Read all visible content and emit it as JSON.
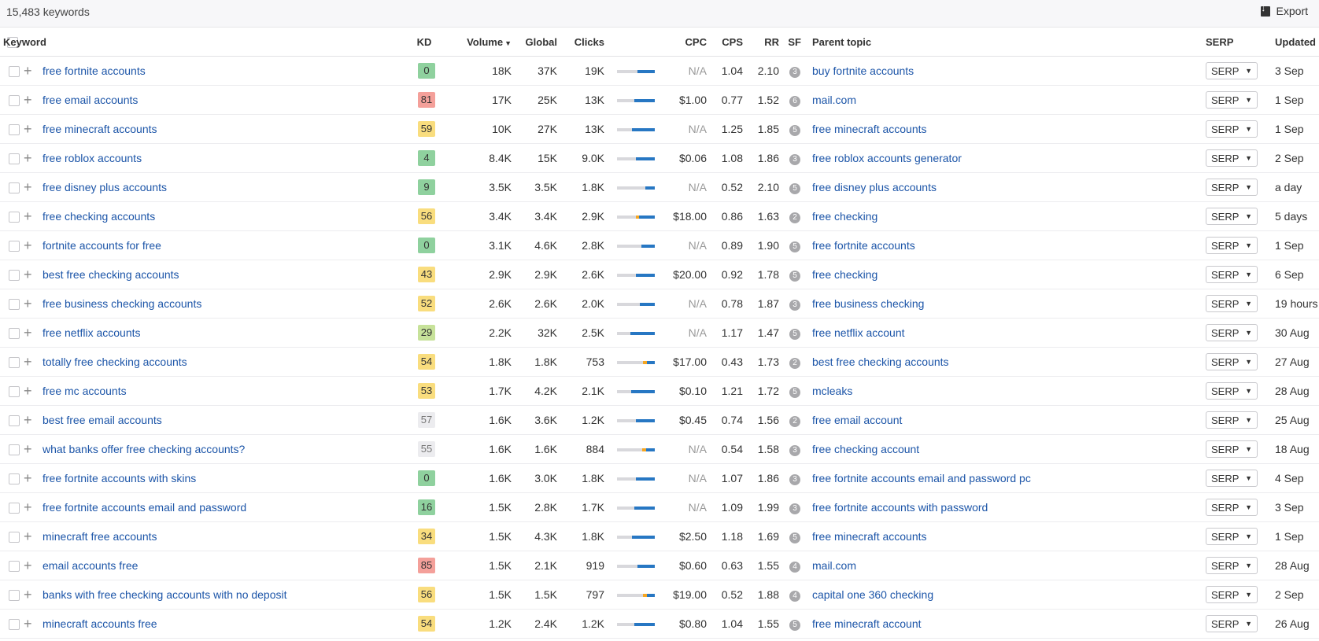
{
  "header": {
    "count": "15,483 keywords",
    "export_label": "Export"
  },
  "columns": {
    "keyword": "Keyword",
    "kd": "KD",
    "volume": "Volume",
    "global": "Global",
    "clicks": "Clicks",
    "cpc": "CPC",
    "cps": "CPS",
    "rr": "RR",
    "sf": "SF",
    "parent": "Parent topic",
    "serp": "SERP",
    "updated": "Updated"
  },
  "serp_label": "SERP",
  "colors": {
    "kd_green": "#8fd19e",
    "kd_lightgreen": "#c7e29a",
    "kd_yellow": "#f9dd7e",
    "kd_red": "#f4a09a",
    "kd_gray": "#ececef",
    "link": "#1c55a8",
    "bar_blue": "#2777c3",
    "bar_orange": "#f5a623"
  },
  "rows": [
    {
      "kw": "free fortnite accounts",
      "kd": "0",
      "kd_color": "#8fd19e",
      "vol": "18K",
      "glob": "37K",
      "clicks": "19K",
      "paid": 0,
      "org": 0.45,
      "cpc": "N/A",
      "cps": "1.04",
      "rr": "2.10",
      "sf": "3",
      "parent": "buy fortnite accounts",
      "upd": "3 Sep"
    },
    {
      "kw": "free email accounts",
      "kd": "81",
      "kd_color": "#f4a09a",
      "vol": "17K",
      "glob": "25K",
      "clicks": "13K",
      "paid": 0,
      "org": 0.55,
      "cpc": "$1.00",
      "cps": "0.77",
      "rr": "1.52",
      "sf": "6",
      "parent": "mail.com",
      "upd": "1 Sep"
    },
    {
      "kw": "free minecraft accounts",
      "kd": "59",
      "kd_color": "#f9dd7e",
      "vol": "10K",
      "glob": "27K",
      "clicks": "13K",
      "paid": 0,
      "org": 0.6,
      "cpc": "N/A",
      "cps": "1.25",
      "rr": "1.85",
      "sf": "5",
      "parent": "free minecraft accounts",
      "upd": "1 Sep"
    },
    {
      "kw": "free roblox accounts",
      "kd": "4",
      "kd_color": "#8fd19e",
      "vol": "8.4K",
      "glob": "15K",
      "clicks": "9.0K",
      "paid": 0,
      "org": 0.5,
      "cpc": "$0.06",
      "cps": "1.08",
      "rr": "1.86",
      "sf": "3",
      "parent": "free roblox accounts generator",
      "upd": "2 Sep"
    },
    {
      "kw": "free disney plus accounts",
      "kd": "9",
      "kd_color": "#8fd19e",
      "vol": "3.5K",
      "glob": "3.5K",
      "clicks": "1.8K",
      "paid": 0,
      "org": 0.25,
      "cpc": "N/A",
      "cps": "0.52",
      "rr": "2.10",
      "sf": "5",
      "parent": "free disney plus accounts",
      "upd": "a day"
    },
    {
      "kw": "free checking accounts",
      "kd": "56",
      "kd_color": "#f9dd7e",
      "vol": "3.4K",
      "glob": "3.4K",
      "clicks": "2.9K",
      "paid": 0.08,
      "org": 0.42,
      "cpc": "$18.00",
      "cps": "0.86",
      "rr": "1.63",
      "sf": "2",
      "parent": "free checking",
      "upd": "5 days"
    },
    {
      "kw": "fortnite accounts for free",
      "kd": "0",
      "kd_color": "#8fd19e",
      "vol": "3.1K",
      "glob": "4.6K",
      "clicks": "2.8K",
      "paid": 0,
      "org": 0.35,
      "cpc": "N/A",
      "cps": "0.89",
      "rr": "1.90",
      "sf": "5",
      "parent": "free fortnite accounts",
      "upd": "1 Sep"
    },
    {
      "kw": "best free checking accounts",
      "kd": "43",
      "kd_color": "#f9dd7e",
      "vol": "2.9K",
      "glob": "2.9K",
      "clicks": "2.6K",
      "paid": 0,
      "org": 0.5,
      "cpc": "$20.00",
      "cps": "0.92",
      "rr": "1.78",
      "sf": "5",
      "parent": "free checking",
      "upd": "6 Sep"
    },
    {
      "kw": "free business checking accounts",
      "kd": "52",
      "kd_color": "#f9dd7e",
      "vol": "2.6K",
      "glob": "2.6K",
      "clicks": "2.0K",
      "paid": 0,
      "org": 0.4,
      "cpc": "N/A",
      "cps": "0.78",
      "rr": "1.87",
      "sf": "3",
      "parent": "free business checking",
      "upd": "19 hours"
    },
    {
      "kw": "free netflix accounts",
      "kd": "29",
      "kd_color": "#c7e29a",
      "vol": "2.2K",
      "glob": "32K",
      "clicks": "2.5K",
      "paid": 0,
      "org": 0.65,
      "cpc": "N/A",
      "cps": "1.17",
      "rr": "1.47",
      "sf": "5",
      "parent": "free netflix account",
      "upd": "30 Aug"
    },
    {
      "kw": "totally free checking accounts",
      "kd": "54",
      "kd_color": "#f9dd7e",
      "vol": "1.8K",
      "glob": "1.8K",
      "clicks": "753",
      "paid": 0.1,
      "org": 0.2,
      "cpc": "$17.00",
      "cps": "0.43",
      "rr": "1.73",
      "sf": "2",
      "parent": "best free checking accounts",
      "upd": "27 Aug"
    },
    {
      "kw": "free mc accounts",
      "kd": "53",
      "kd_color": "#f9dd7e",
      "vol": "1.7K",
      "glob": "4.2K",
      "clicks": "2.1K",
      "paid": 0,
      "org": 0.62,
      "cpc": "$0.10",
      "cps": "1.21",
      "rr": "1.72",
      "sf": "5",
      "parent": "mcleaks",
      "upd": "28 Aug"
    },
    {
      "kw": "best free email accounts",
      "kd": "57",
      "kd_color": "#ececef",
      "vol": "1.6K",
      "glob": "3.6K",
      "clicks": "1.2K",
      "paid": 0,
      "org": 0.5,
      "cpc": "$0.45",
      "cps": "0.74",
      "rr": "1.56",
      "sf": "2",
      "parent": "free email account",
      "upd": "25 Aug"
    },
    {
      "kw": "what banks offer free checking accounts?",
      "kd": "55",
      "kd_color": "#ececef",
      "vol": "1.6K",
      "glob": "1.6K",
      "clicks": "884",
      "paid": 0.1,
      "org": 0.22,
      "cpc": "N/A",
      "cps": "0.54",
      "rr": "1.58",
      "sf": "3",
      "parent": "free checking account",
      "upd": "18 Aug"
    },
    {
      "kw": "free fortnite accounts with skins",
      "kd": "0",
      "kd_color": "#8fd19e",
      "vol": "1.6K",
      "glob": "3.0K",
      "clicks": "1.8K",
      "paid": 0,
      "org": 0.5,
      "cpc": "N/A",
      "cps": "1.07",
      "rr": "1.86",
      "sf": "3",
      "parent": "free fortnite accounts email and password pc",
      "upd": "4 Sep"
    },
    {
      "kw": "free fortnite accounts email and password",
      "kd": "16",
      "kd_color": "#8fd19e",
      "vol": "1.5K",
      "glob": "2.8K",
      "clicks": "1.7K",
      "paid": 0,
      "org": 0.55,
      "cpc": "N/A",
      "cps": "1.09",
      "rr": "1.99",
      "sf": "3",
      "parent": "free fortnite accounts with password",
      "upd": "3 Sep"
    },
    {
      "kw": "minecraft free accounts",
      "kd": "34",
      "kd_color": "#f9dd7e",
      "vol": "1.5K",
      "glob": "4.3K",
      "clicks": "1.8K",
      "paid": 0,
      "org": 0.6,
      "cpc": "$2.50",
      "cps": "1.18",
      "rr": "1.69",
      "sf": "5",
      "parent": "free minecraft accounts",
      "upd": "1 Sep"
    },
    {
      "kw": "email accounts free",
      "kd": "85",
      "kd_color": "#f4a09a",
      "vol": "1.5K",
      "glob": "2.1K",
      "clicks": "919",
      "paid": 0,
      "org": 0.45,
      "cpc": "$0.60",
      "cps": "0.63",
      "rr": "1.55",
      "sf": "4",
      "parent": "mail.com",
      "upd": "28 Aug"
    },
    {
      "kw": "banks with free checking accounts with no deposit",
      "kd": "56",
      "kd_color": "#f9dd7e",
      "vol": "1.5K",
      "glob": "1.5K",
      "clicks": "797",
      "paid": 0.1,
      "org": 0.2,
      "cpc": "$19.00",
      "cps": "0.52",
      "rr": "1.88",
      "sf": "4",
      "parent": "capital one 360 checking",
      "upd": "2 Sep"
    },
    {
      "kw": "minecraft accounts free",
      "kd": "54",
      "kd_color": "#f9dd7e",
      "vol": "1.2K",
      "glob": "2.4K",
      "clicks": "1.2K",
      "paid": 0,
      "org": 0.55,
      "cpc": "$0.80",
      "cps": "1.04",
      "rr": "1.55",
      "sf": "5",
      "parent": "free minecraft account",
      "upd": "26 Aug"
    }
  ]
}
